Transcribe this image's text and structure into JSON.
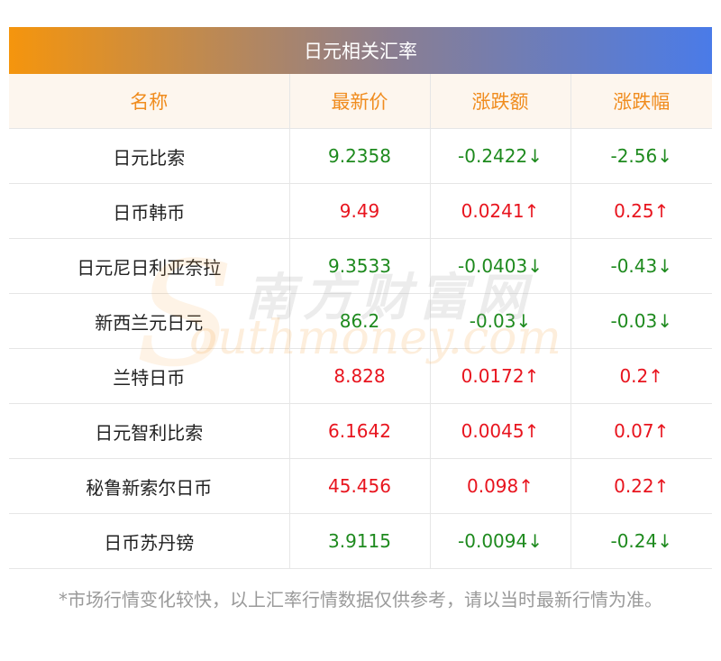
{
  "title": "日元相关汇率",
  "headers": [
    "名称",
    "最新价",
    "涨跌额",
    "涨跌幅"
  ],
  "rows": [
    {
      "name": "日元比索",
      "price": "9.2358",
      "change": "-0.2422↓",
      "pct": "-2.56↓",
      "dir": "down"
    },
    {
      "name": "日币韩币",
      "price": "9.49",
      "change": "0.0241↑",
      "pct": "0.25↑",
      "dir": "up"
    },
    {
      "name": "日元尼日利亚奈拉",
      "price": "9.3533",
      "change": "-0.0403↓",
      "pct": "-0.43↓",
      "dir": "down"
    },
    {
      "name": "新西兰元日元",
      "price": "86.2",
      "change": "-0.03↓",
      "pct": "-0.03↓",
      "dir": "down"
    },
    {
      "name": "兰特日币",
      "price": "8.828",
      "change": "0.0172↑",
      "pct": "0.2↑",
      "dir": "up"
    },
    {
      "name": "日元智利比索",
      "price": "6.1642",
      "change": "0.0045↑",
      "pct": "0.07↑",
      "dir": "up"
    },
    {
      "name": "秘鲁新索尔日币",
      "price": "45.456",
      "change": "0.098↑",
      "pct": "0.22↑",
      "dir": "up"
    },
    {
      "name": "日币苏丹镑",
      "price": "3.9115",
      "change": "-0.0094↓",
      "pct": "-0.24↓",
      "dir": "down"
    }
  ],
  "note": "*市场行情变化较快，以上汇率行情数据仅供参考，请以当时最新行情为准。",
  "watermark": {
    "cn": "南方财富网",
    "en": "outhmoney.com",
    "s": "S"
  },
  "colors": {
    "up": "#e8141e",
    "down": "#1e8a1e",
    "header_text": "#f08c1e",
    "header_bg": "#fdf6ee"
  }
}
